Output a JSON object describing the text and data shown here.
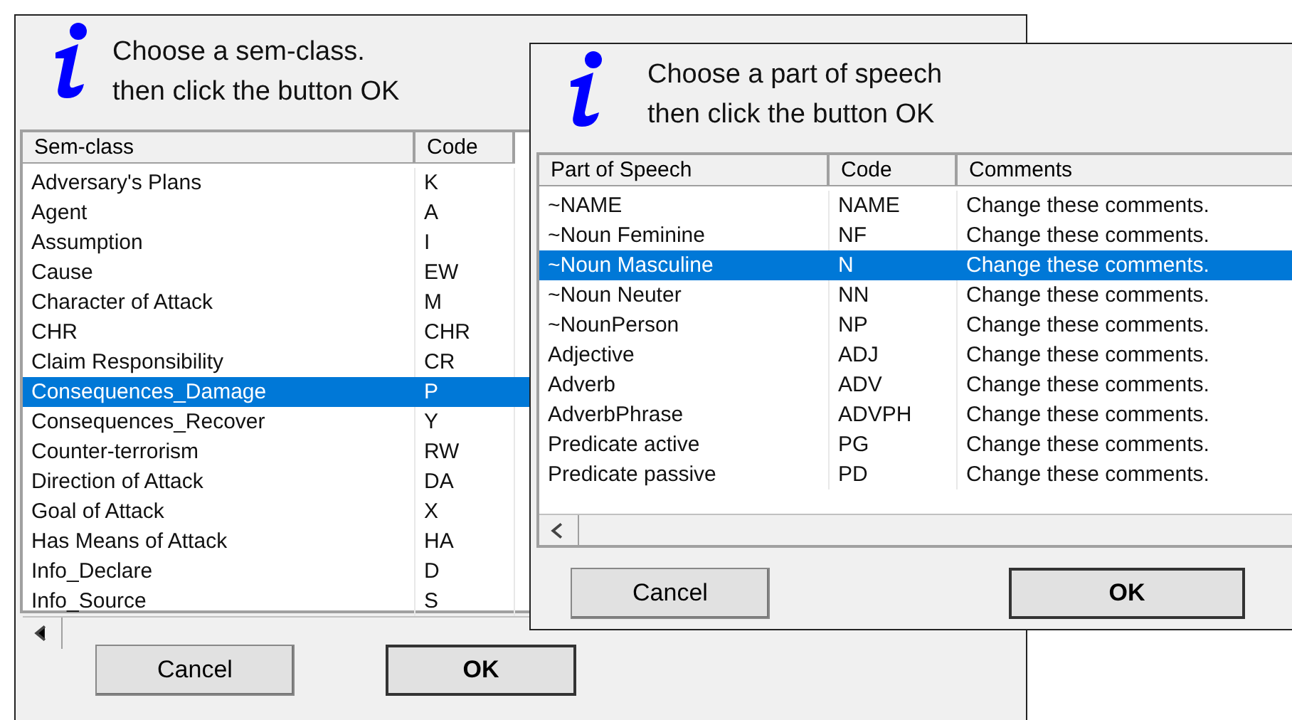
{
  "dialogs": [
    {
      "message_lines": [
        "Choose a sem-class.",
        "then click the button OK"
      ],
      "table": {
        "columns": [
          "Sem-class",
          "Code"
        ],
        "rows": [
          {
            "cells": [
              "Adversary's Plans",
              "K"
            ],
            "selected": false
          },
          {
            "cells": [
              "Agent",
              "A"
            ],
            "selected": false
          },
          {
            "cells": [
              "Assumption",
              "I"
            ],
            "selected": false
          },
          {
            "cells": [
              "Cause",
              "EW"
            ],
            "selected": false
          },
          {
            "cells": [
              "Character of Attack",
              "M"
            ],
            "selected": false
          },
          {
            "cells": [
              "CHR",
              "CHR"
            ],
            "selected": false
          },
          {
            "cells": [
              "Claim Responsibility",
              "CR"
            ],
            "selected": false
          },
          {
            "cells": [
              "Consequences_Damage",
              "P"
            ],
            "selected": true
          },
          {
            "cells": [
              "Consequences_Recover",
              "Y"
            ],
            "selected": false
          },
          {
            "cells": [
              "Counter-terrorism",
              "RW"
            ],
            "selected": false
          },
          {
            "cells": [
              "Direction of Attack",
              "DA"
            ],
            "selected": false
          },
          {
            "cells": [
              "Goal of Attack",
              "X"
            ],
            "selected": false
          },
          {
            "cells": [
              "Has Means of Attack",
              "HA"
            ],
            "selected": false
          },
          {
            "cells": [
              "Info_Declare",
              "D"
            ],
            "selected": false
          },
          {
            "cells": [
              "Info_Source",
              "S"
            ],
            "selected": false
          }
        ]
      },
      "buttons": [
        {
          "label": "Cancel",
          "default": false
        },
        {
          "label": "OK",
          "default": true
        }
      ]
    },
    {
      "message_lines": [
        "Choose a part of speech",
        "then click the button OK"
      ],
      "table": {
        "columns": [
          "Part of Speech",
          "Code",
          "Comments"
        ],
        "rows": [
          {
            "cells": [
              "~NAME",
              "NAME",
              "Change these comments."
            ],
            "selected": false
          },
          {
            "cells": [
              "~Noun Feminine",
              "NF",
              "Change these comments."
            ],
            "selected": false
          },
          {
            "cells": [
              "~Noun Masculine",
              "N",
              "Change these comments."
            ],
            "selected": true
          },
          {
            "cells": [
              "~Noun Neuter",
              "NN",
              "Change these comments."
            ],
            "selected": false
          },
          {
            "cells": [
              "~NounPerson",
              "NP",
              "Change these comments."
            ],
            "selected": false
          },
          {
            "cells": [
              "Adjective",
              "ADJ",
              "Change these comments."
            ],
            "selected": false
          },
          {
            "cells": [
              "Adverb",
              "ADV",
              "Change these comments."
            ],
            "selected": false
          },
          {
            "cells": [
              "AdverbPhrase",
              "ADVPH",
              "Change these comments."
            ],
            "selected": false
          },
          {
            "cells": [
              "Predicate active",
              "PG",
              "Change these comments."
            ],
            "selected": false
          },
          {
            "cells": [
              "Predicate passive",
              "PD",
              "Change these comments."
            ],
            "selected": false
          }
        ]
      },
      "buttons": [
        {
          "label": "Cancel",
          "default": false
        },
        {
          "label": "OK",
          "default": true
        }
      ]
    }
  ]
}
